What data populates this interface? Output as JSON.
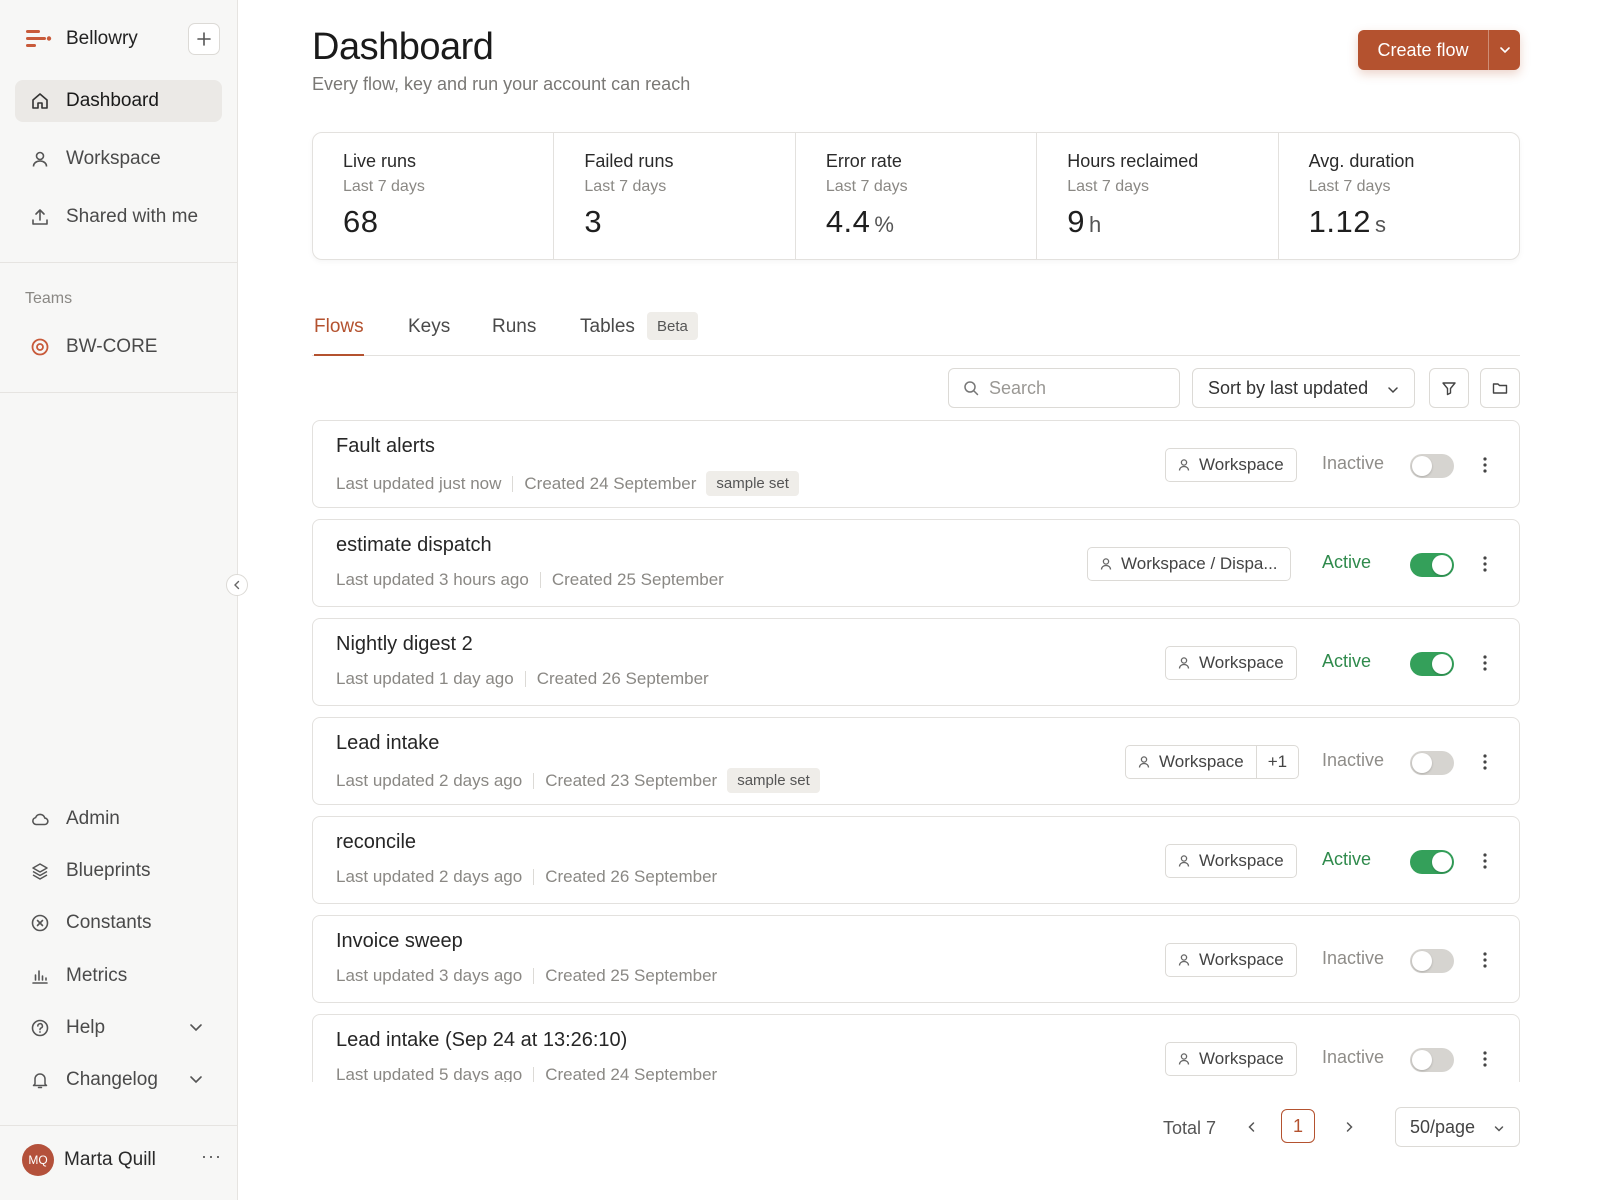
{
  "brand": {
    "name": "Bellowry"
  },
  "sidebar": {
    "nav": [
      {
        "label": "Dashboard",
        "icon": "home-icon",
        "active": true
      },
      {
        "label": "Workspace",
        "icon": "user-icon",
        "active": false
      },
      {
        "label": "Shared with me",
        "icon": "share-upload-icon",
        "active": false
      }
    ],
    "teams_heading": "Teams",
    "teams": [
      {
        "label": "BW-CORE",
        "icon": "team-target-icon",
        "color": "#c85a3a"
      }
    ],
    "bottom": [
      {
        "label": "Admin",
        "icon": "cloud-icon"
      },
      {
        "label": "Blueprints",
        "icon": "layers-icon"
      },
      {
        "label": "Constants",
        "icon": "circle-x-icon"
      },
      {
        "label": "Metrics",
        "icon": "bar-chart-icon"
      },
      {
        "label": "Help",
        "icon": "help-circle-icon",
        "expandable": true
      },
      {
        "label": "Changelog",
        "icon": "bell-icon",
        "expandable": true
      }
    ],
    "user": {
      "initials": "MQ",
      "name": "Marta Quill",
      "more": "···"
    }
  },
  "header": {
    "title": "Dashboard",
    "subtitle": "Every flow, key and run your account can reach",
    "create_label": "Create flow"
  },
  "stats": [
    {
      "label": "Live runs",
      "period": "Last 7 days",
      "value": "68",
      "unit": ""
    },
    {
      "label": "Failed runs",
      "period": "Last 7 days",
      "value": "3",
      "unit": ""
    },
    {
      "label": "Error rate",
      "period": "Last 7 days",
      "value": "4.4",
      "unit": "%"
    },
    {
      "label": "Hours reclaimed",
      "period": "Last 7 days",
      "value": "9",
      "unit": "h"
    },
    {
      "label": "Avg. duration",
      "period": "Last 7 days",
      "value": "1.12",
      "unit": "s"
    }
  ],
  "tabs": [
    {
      "label": "Flows",
      "active": true
    },
    {
      "label": "Keys",
      "active": false
    },
    {
      "label": "Runs",
      "active": false
    },
    {
      "label": "Tables",
      "active": false,
      "badge": "Beta"
    }
  ],
  "toolbar": {
    "search_placeholder": "Search",
    "sort_label": "Sort by last updated"
  },
  "flows": [
    {
      "name": "Fault alerts",
      "updated": "Last updated just now",
      "created": "Created 24 September",
      "tag": "sample set",
      "workspace": "Workspace",
      "extra": "",
      "status": "Inactive",
      "enabled": false
    },
    {
      "name": "estimate dispatch",
      "updated": "Last updated 3 hours ago",
      "created": "Created 25 September",
      "tag": "",
      "workspace": "Workspace / Dispa...",
      "extra": "",
      "status": "Active",
      "enabled": true
    },
    {
      "name": "Nightly digest 2",
      "updated": "Last updated 1 day ago",
      "created": "Created 26 September",
      "tag": "",
      "workspace": "Workspace",
      "extra": "",
      "status": "Active",
      "enabled": true
    },
    {
      "name": "Lead intake",
      "updated": "Last updated 2 days ago",
      "created": "Created 23 September",
      "tag": "sample set",
      "workspace": "Workspace",
      "extra": "+1",
      "status": "Inactive",
      "enabled": false
    },
    {
      "name": "reconcile",
      "updated": "Last updated 2 days ago",
      "created": "Created 26 September",
      "tag": "",
      "workspace": "Workspace",
      "extra": "",
      "status": "Active",
      "enabled": true
    },
    {
      "name": "Invoice sweep",
      "updated": "Last updated 3 days ago",
      "created": "Created 25 September",
      "tag": "",
      "workspace": "Workspace",
      "extra": "",
      "status": "Inactive",
      "enabled": false
    },
    {
      "name": "Lead intake (Sep 24 at 13:26:10)",
      "updated": "Last updated 5 days ago",
      "created": "Created 24 September",
      "tag": "",
      "workspace": "Workspace",
      "extra": "",
      "status": "Inactive",
      "enabled": false
    }
  ],
  "pagination": {
    "total": "Total 7",
    "page": "1",
    "per_page": "50/page"
  },
  "colors": {
    "accent": "#b4522f",
    "active": "#2f8a4c",
    "toggle_on": "#34a05a",
    "toggle_off": "#d6d4d0"
  }
}
